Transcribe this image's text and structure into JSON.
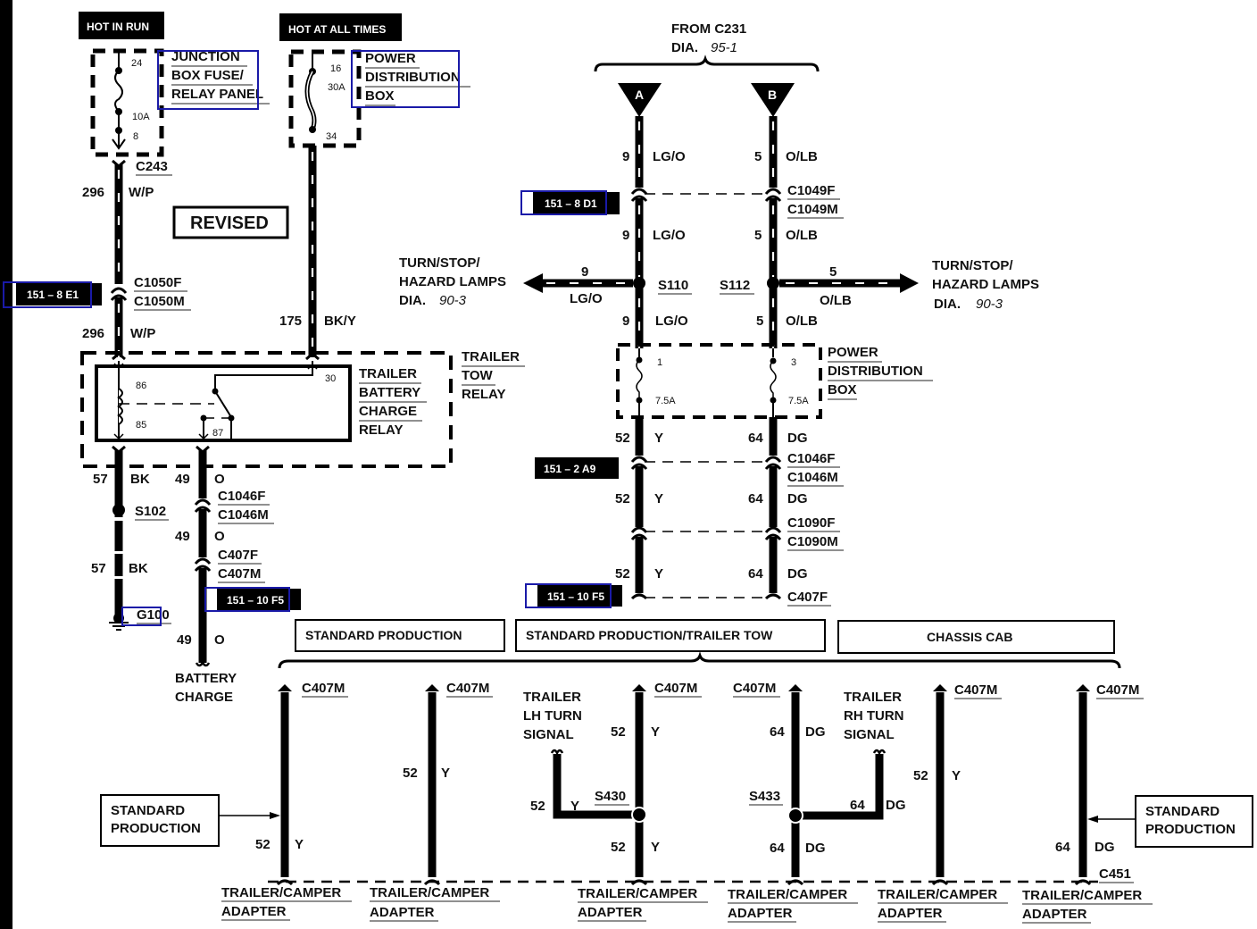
{
  "headers": {
    "hot_in_run": "HOT IN RUN",
    "hot_at_all_times": "HOT AT ALL TIMES",
    "revised": "REVISED",
    "from_c231": "FROM C231",
    "dia_label": "DIA.",
    "from_c231_dia": "95-1"
  },
  "junction_box": {
    "lines": [
      "JUNCTION",
      "BOX FUSE/",
      "RELAY PANEL"
    ],
    "pin_in": "24",
    "pin_out": "8",
    "rating": "10A"
  },
  "pdb_top": {
    "lines": [
      "POWER",
      "DISTRIBUTION",
      "BOX"
    ],
    "pin_in": "16",
    "pin_out": "34",
    "rating": "30A"
  },
  "pdb_mid": {
    "lines": [
      "POWER",
      "DISTRIBUTION",
      "BOX"
    ],
    "fuse_a_pin": "1",
    "fuse_a_rating": "7.5A",
    "fuse_b_pin": "3",
    "fuse_b_rating": "7.5A"
  },
  "relay": {
    "inner_lines": [
      "TRAILER",
      "BATTERY",
      "CHARGE",
      "RELAY"
    ],
    "outer_lines": [
      "TRAILER",
      "TOW",
      "RELAY"
    ],
    "pins": {
      "p86": "86",
      "p85": "85",
      "p87": "87",
      "p30": "30"
    }
  },
  "page_refs": {
    "ref_e1": "151 – 8 E1",
    "ref_d1": "151 – 8 D1",
    "ref_a9": "151 – 2 A9",
    "ref_f5_left": "151 – 10 F5",
    "ref_f5_right": "151 – 10 F5"
  },
  "left_circuits": {
    "c243": "C243",
    "w296_num": "296",
    "w296_color": "W/P",
    "c1050f": "C1050F",
    "c1050m": "C1050M",
    "w296b_num": "296",
    "w296b_color": "W/P",
    "w175_num": "175",
    "w175_color": "BK/Y",
    "w57_num": "57",
    "w57_color": "BK",
    "s102": "S102",
    "w57b_num": "57",
    "w57b_color": "BK",
    "g100": "G100",
    "w49_num": "49",
    "w49_color": "O",
    "c1046f": "C1046F",
    "c1046m": "C1046M",
    "w49b_num": "49",
    "w49b_color": "O",
    "c407f": "C407F",
    "c407m": "C407M",
    "w49c_num": "49",
    "w49c_color": "O",
    "battery_charge": [
      "BATTERY",
      "CHARGE"
    ]
  },
  "right_circuits": {
    "conn_a": "A",
    "conn_b": "B",
    "a1_num": "9",
    "a1_color": "LG/O",
    "b1_num": "5",
    "b1_color": "O/LB",
    "c1049f": "C1049F",
    "c1049m": "C1049M",
    "a2_num": "9",
    "a2_color": "LG/O",
    "b2_num": "5",
    "b2_color": "O/LB",
    "s110": "S110",
    "s112": "S112",
    "left_branch_num": "9",
    "left_branch_color": "LG/O",
    "right_branch_num": "5",
    "right_branch_color": "O/LB",
    "a3_num": "9",
    "a3_color": "LG/O",
    "b3_num": "5",
    "b3_color": "O/LB",
    "turn_left": [
      "TURN/STOP/",
      "HAZARD LAMPS",
      "DIA.",
      "90-3"
    ],
    "turn_right": [
      "TURN/STOP/",
      "HAZARD LAMPS",
      "DIA.",
      "90-3"
    ],
    "a4_num": "52",
    "a4_color": "Y",
    "b4_num": "64",
    "b4_color": "DG",
    "c1046f": "C1046F",
    "c1046m": "C1046M",
    "a5_num": "52",
    "a5_color": "Y",
    "b5_num": "64",
    "b5_color": "DG",
    "c1090f": "C1090F",
    "c1090m": "C1090M",
    "a6_num": "52",
    "a6_color": "Y",
    "b6_num": "64",
    "b6_color": "DG",
    "c407f": "C407F"
  },
  "variants": {
    "standard_production": "STANDARD PRODUCTION",
    "std_trailer_tow": "STANDARD PRODUCTION/TRAILER TOW",
    "chassis_cab": "CHASSIS CAB"
  },
  "bottom": {
    "std_prod_left": [
      "STANDARD",
      "PRODUCTION"
    ],
    "std_prod_right": [
      "STANDARD",
      "PRODUCTION"
    ],
    "adapter": [
      "TRAILER/CAMPER",
      "ADAPTER"
    ],
    "c407m": "C407M",
    "c451": "C451",
    "lh_signal": [
      "TRAILER",
      "LH TURN",
      "SIGNAL"
    ],
    "rh_signal": [
      "TRAILER",
      "RH TURN",
      "SIGNAL"
    ],
    "s430": "S430",
    "s433": "S433",
    "wires": [
      {
        "num": "52",
        "color": "Y"
      },
      {
        "num": "52",
        "color": "Y"
      },
      {
        "num": "52",
        "color": "Y"
      },
      {
        "num": "52",
        "color": "Y"
      },
      {
        "num": "52",
        "color": "Y"
      },
      {
        "num": "64",
        "color": "DG"
      },
      {
        "num": "64",
        "color": "DG"
      },
      {
        "num": "64",
        "color": "DG"
      },
      {
        "num": "52",
        "color": "Y"
      },
      {
        "num": "64",
        "color": "DG"
      }
    ]
  }
}
